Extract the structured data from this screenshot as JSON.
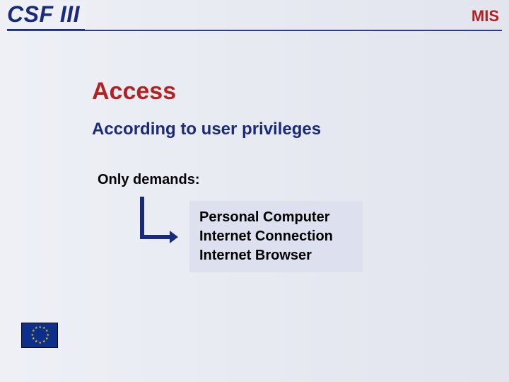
{
  "header": {
    "left_title": "CSF III",
    "right_title": "MIS"
  },
  "content": {
    "heading": "Access",
    "subtitle": "According to user privileges",
    "demands_label": "Only demands:",
    "requirements": {
      "line1": "Personal Computer",
      "line2": "Internet Connection",
      "line3": "Internet Browser"
    }
  },
  "footer": {
    "flag_name": "eu-flag"
  },
  "colors": {
    "accent_blue": "#1a2b7a",
    "accent_red": "#b22222",
    "flag_bg": "#0b2f8a",
    "flag_star": "#f7c600"
  }
}
